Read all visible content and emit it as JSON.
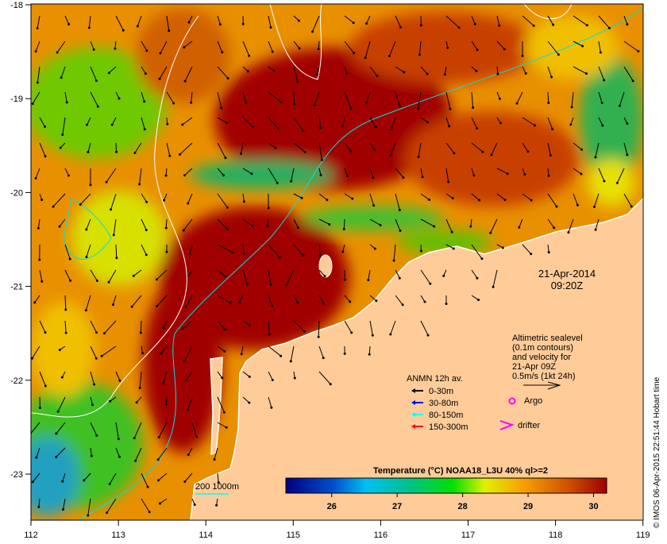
{
  "map": {
    "date": "21-Apr-2014",
    "time": "09:20Z",
    "lon_ticks": [
      "112",
      "113",
      "114",
      "115",
      "116",
      "117",
      "118",
      "119"
    ],
    "lat_ticks": [
      "-18",
      "-19",
      "-20",
      "-21",
      "-22",
      "-23"
    ],
    "credit": "© IMOS 06-Apr-2015 22:51:44 Hobart time"
  },
  "altimetry_note": {
    "lines": [
      "Altimetric sealevel",
      "(0.1m contours)",
      "and velocity for",
      "21-Apr 09Z",
      "0.5m/s (1kt 24h)"
    ]
  },
  "anmn_legend": {
    "title": "ANMN 12h av.",
    "items": [
      {
        "label": "0-30m",
        "color": "#000000"
      },
      {
        "label": "30-80m",
        "color": "#0000FF"
      },
      {
        "label": "80-150m",
        "color": "#00FFFF"
      },
      {
        "label": "150-300m",
        "color": "#FF0000"
      }
    ]
  },
  "markers": {
    "argo": {
      "label": "Argo",
      "color": "#FF00FF"
    },
    "drifter": {
      "label": "drifter",
      "color": "#FF00FF"
    }
  },
  "isobath": {
    "label": "200  1000m",
    "color": "#00FFFF"
  },
  "colorbar": {
    "title": "Temperature (°C) NOAA18_L3U 40% ql>=2",
    "ticks": [
      "26",
      "27",
      "28",
      "29",
      "30"
    ],
    "range": [
      25.3,
      30.2
    ]
  },
  "colors": {
    "land": "#FFCC99",
    "hot": "#A00000",
    "warm": "#E07000"
  }
}
